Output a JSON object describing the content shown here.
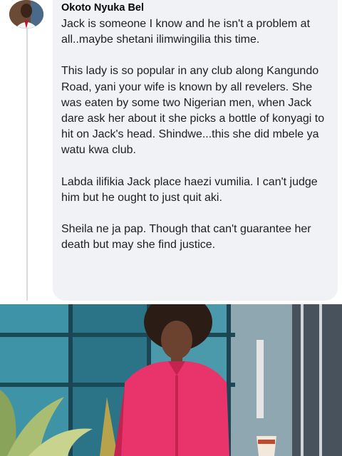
{
  "comment": {
    "author": "Okoto Nyuka Bel",
    "paragraphs": [
      "Jack is someone I know and he isn't a problem at all..maybe shetani ilimwingilia this time.",
      "This lady is so popular in any club along Kangundo Road, yani your wife is known by all revelers. She was eaten by some two Nigerian men, when Jack dare ask her about it she picks a bottle of konyagi to hit on Jack's head. Shindwe...this she did mbele ya watu kwa club.",
      "Labda ilifikia Jack place haezi vumilia. I can't judge him but he ought to just quit aki.",
      "Sheila ne ja pap. Though that can't guarantee her death but may she find justice."
    ]
  },
  "colors": {
    "bubble_background": "#f0f2f5",
    "author_text": "#050505",
    "body_text": "#1c1e21",
    "shirt": "#e8336b",
    "glass_wall": "#2f7f95"
  }
}
